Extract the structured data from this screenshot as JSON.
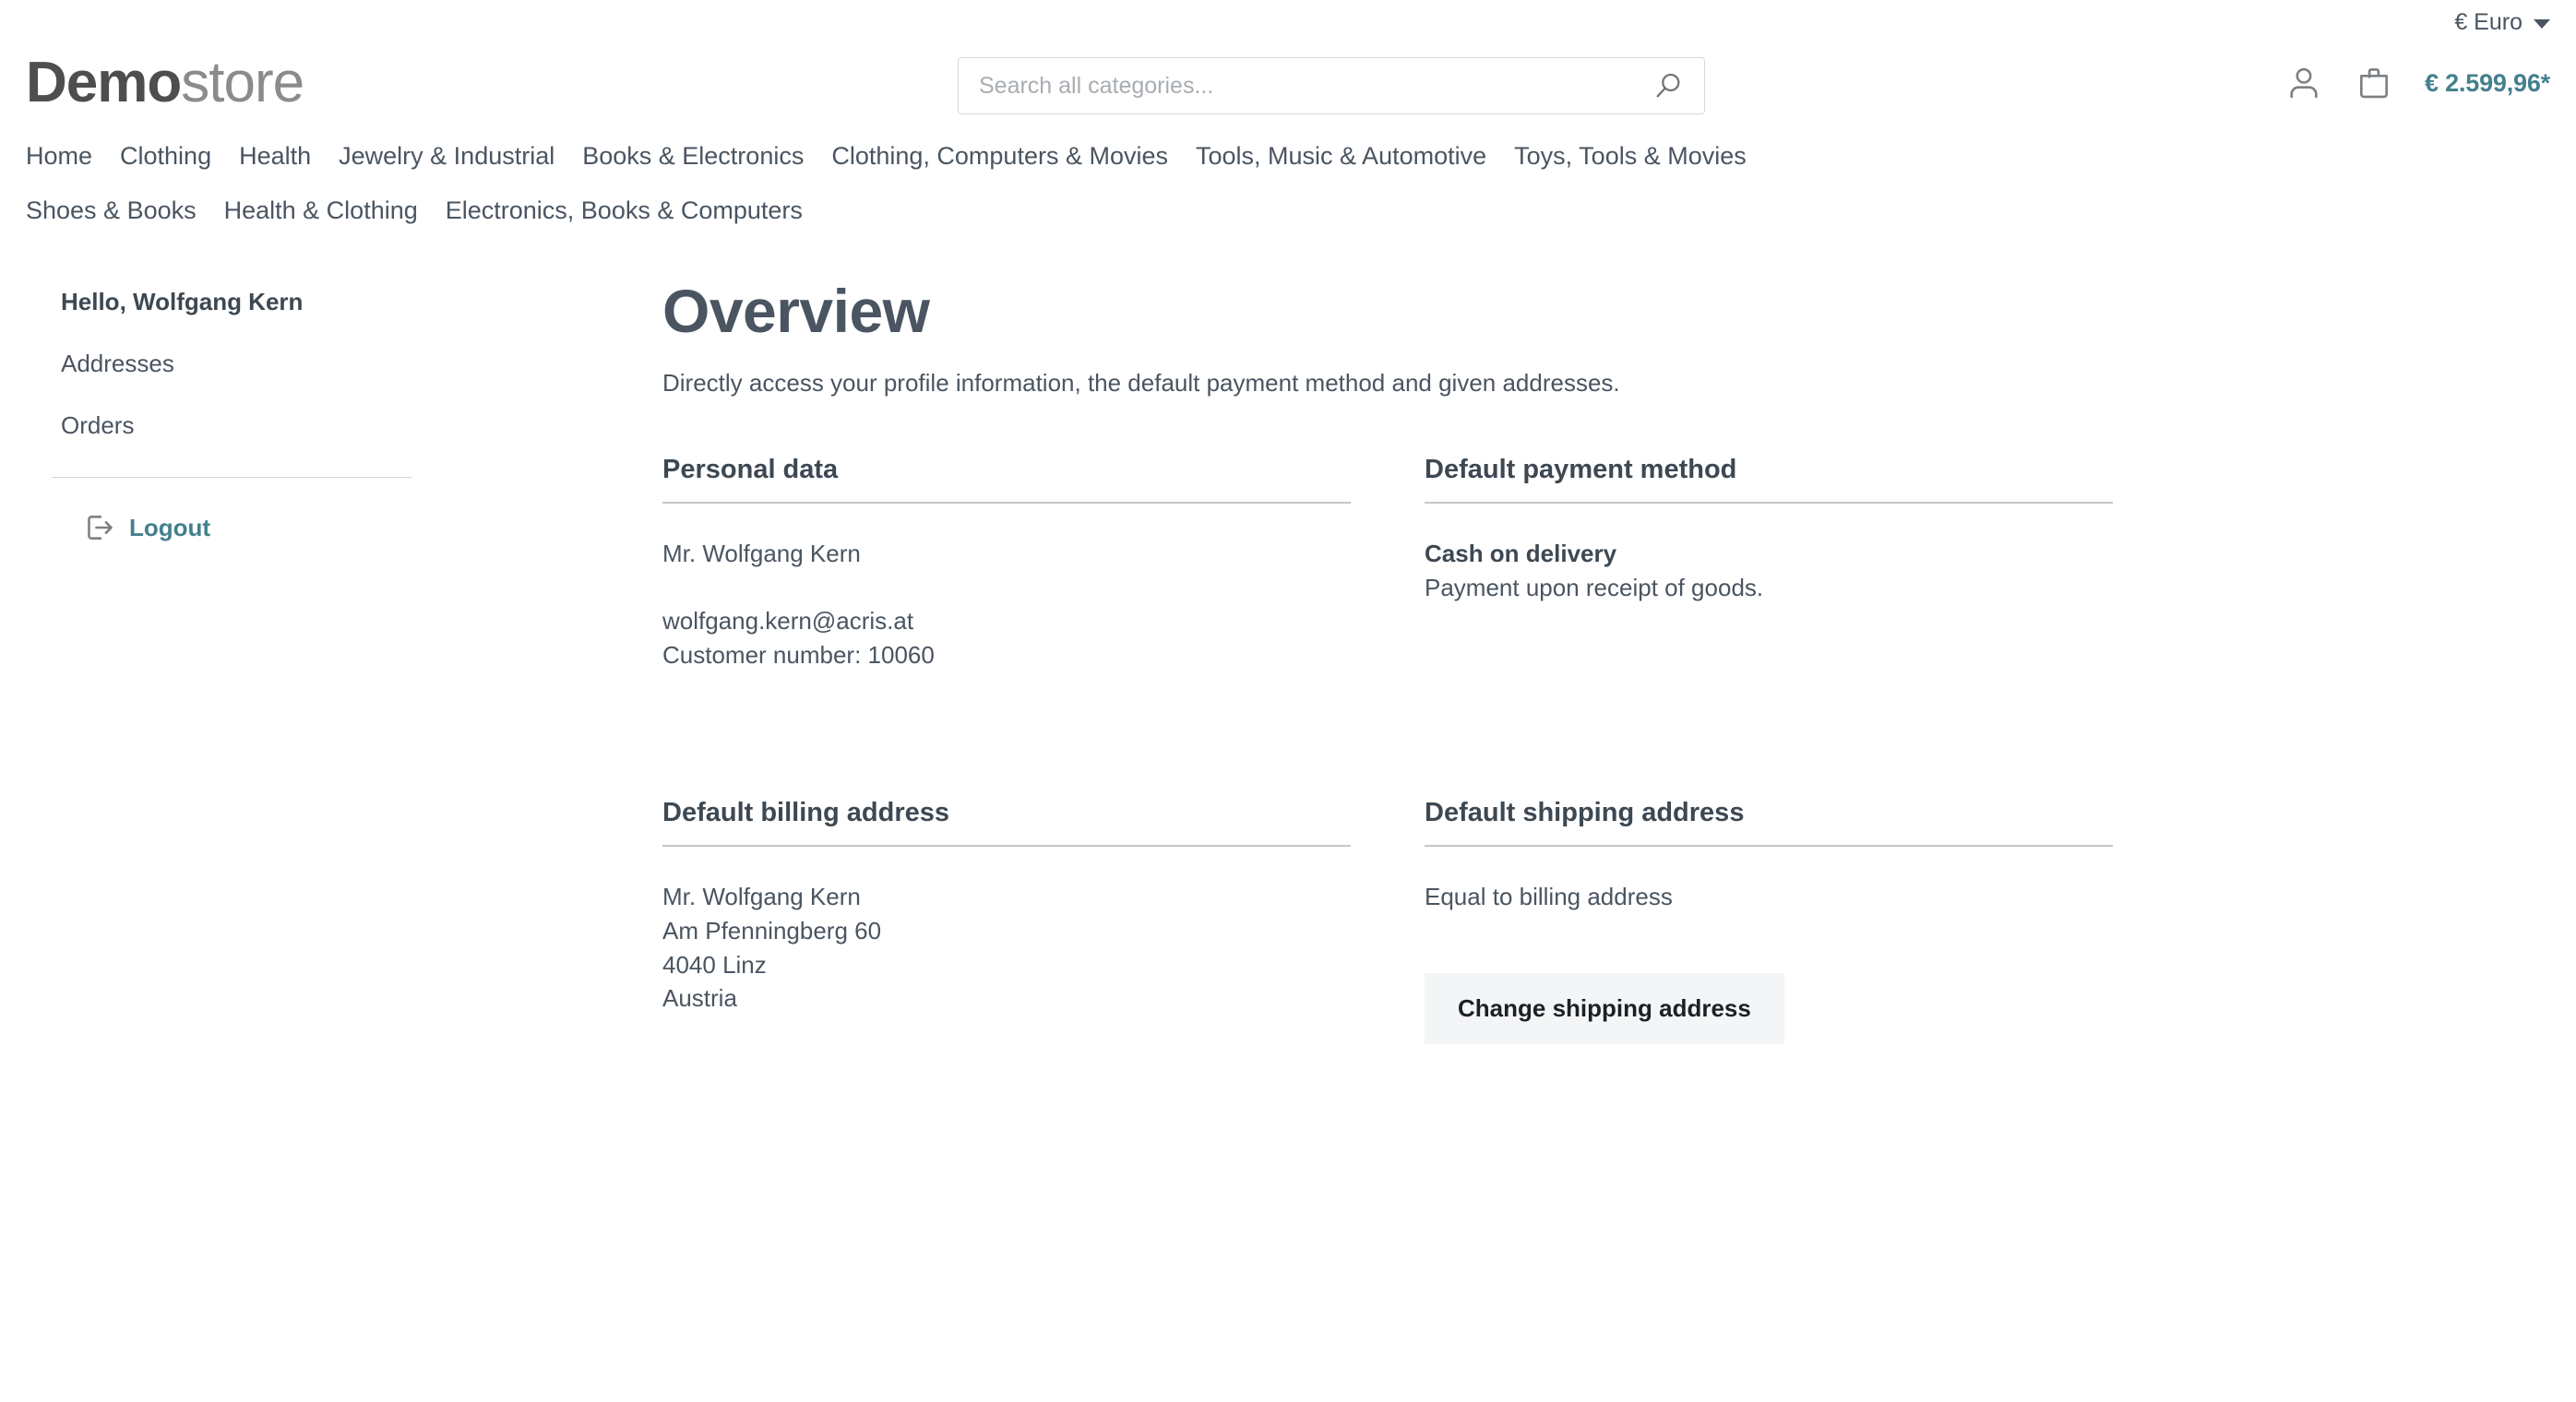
{
  "topbar": {
    "currency_label": "€ Euro"
  },
  "header": {
    "logo_bold": "Demo",
    "logo_light": "store",
    "search_placeholder": "Search all categories...",
    "search_value": "",
    "cart_total": "€ 2.599,96*"
  },
  "nav": {
    "row1": [
      "Home",
      "Clothing",
      "Health",
      "Jewelry & Industrial",
      "Books & Electronics",
      "Clothing, Computers & Movies",
      "Tools, Music & Automotive",
      "Toys, Tools & Movies"
    ],
    "row2": [
      "Shoes & Books",
      "Health & Clothing",
      "Electronics, Books & Computers"
    ]
  },
  "sidebar": {
    "greeting": "Hello, Wolfgang Kern",
    "items": [
      {
        "label": "Addresses"
      },
      {
        "label": "Orders"
      }
    ],
    "logout_label": "Logout"
  },
  "main": {
    "title": "Overview",
    "subtitle": "Directly access your profile information, the default payment method and given addresses.",
    "personal_data": {
      "title": "Personal data",
      "name": "Mr. Wolfgang Kern",
      "email": "wolfgang.kern@acris.at",
      "customer_number": "Customer number: 10060"
    },
    "payment_method": {
      "title": "Default payment method",
      "name": "Cash on delivery",
      "description": "Payment upon receipt of goods."
    },
    "billing_address": {
      "title": "Default billing address",
      "line1": "Mr. Wolfgang Kern",
      "line2": "Am Pfenningberg 60",
      "line3": "4040 Linz",
      "line4": "Austria"
    },
    "shipping_address": {
      "title": "Default shipping address",
      "line1": "Equal to billing address",
      "change_button": "Change shipping address"
    }
  },
  "colors": {
    "accent_teal": "#44808d",
    "text_slate": "#4a5561",
    "rule_gray": "#c4c6c9",
    "button_bg": "#f4f5f6"
  }
}
